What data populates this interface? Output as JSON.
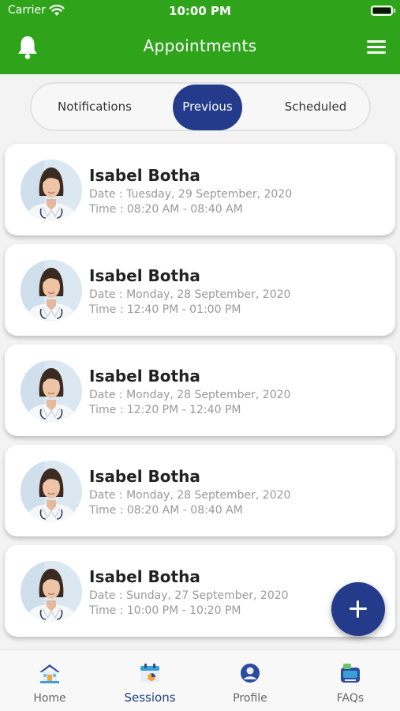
{
  "status_bar": {
    "carrier": "Carrier",
    "time": "10:00 PM"
  },
  "header": {
    "title": "Appointments",
    "left_icon": "bell-icon",
    "right_icon": "menu-icon"
  },
  "segments": [
    {
      "label": "Notifications",
      "selected": false
    },
    {
      "label": "Previous",
      "selected": true
    },
    {
      "label": "Scheduled",
      "selected": false
    }
  ],
  "appointments": [
    {
      "name": "Isabel Botha",
      "date": "Date : Tuesday, 29 September, 2020",
      "time": "Time : 08:20 AM - 08:40 AM"
    },
    {
      "name": "Isabel Botha",
      "date": "Date : Monday, 28 September, 2020",
      "time": "Time : 12:40 PM - 01:00 PM"
    },
    {
      "name": "Isabel Botha",
      "date": "Date : Monday, 28 September, 2020",
      "time": "Time : 12:20 PM - 12:40 PM"
    },
    {
      "name": "Isabel Botha",
      "date": "Date : Monday, 28 September, 2020",
      "time": "Time : 08:20 AM - 08:40 AM"
    },
    {
      "name": "Isabel Botha",
      "date": "Date : Sunday, 27 September, 2020",
      "time": "Time : 10:00 PM - 10:20 PM"
    }
  ],
  "fab": {
    "icon": "plus-icon"
  },
  "tabs": [
    {
      "label": "Home",
      "icon": "home-icon",
      "active": false
    },
    {
      "label": "Sessions",
      "icon": "calendar-icon",
      "active": true
    },
    {
      "label": "Profile",
      "icon": "profile-icon",
      "active": false
    },
    {
      "label": "FAQs",
      "icon": "faq-icon",
      "active": false
    }
  ],
  "colors": {
    "header_green": "#2fa41b",
    "accent_blue": "#233b8a",
    "background": "#f3f3f3"
  }
}
